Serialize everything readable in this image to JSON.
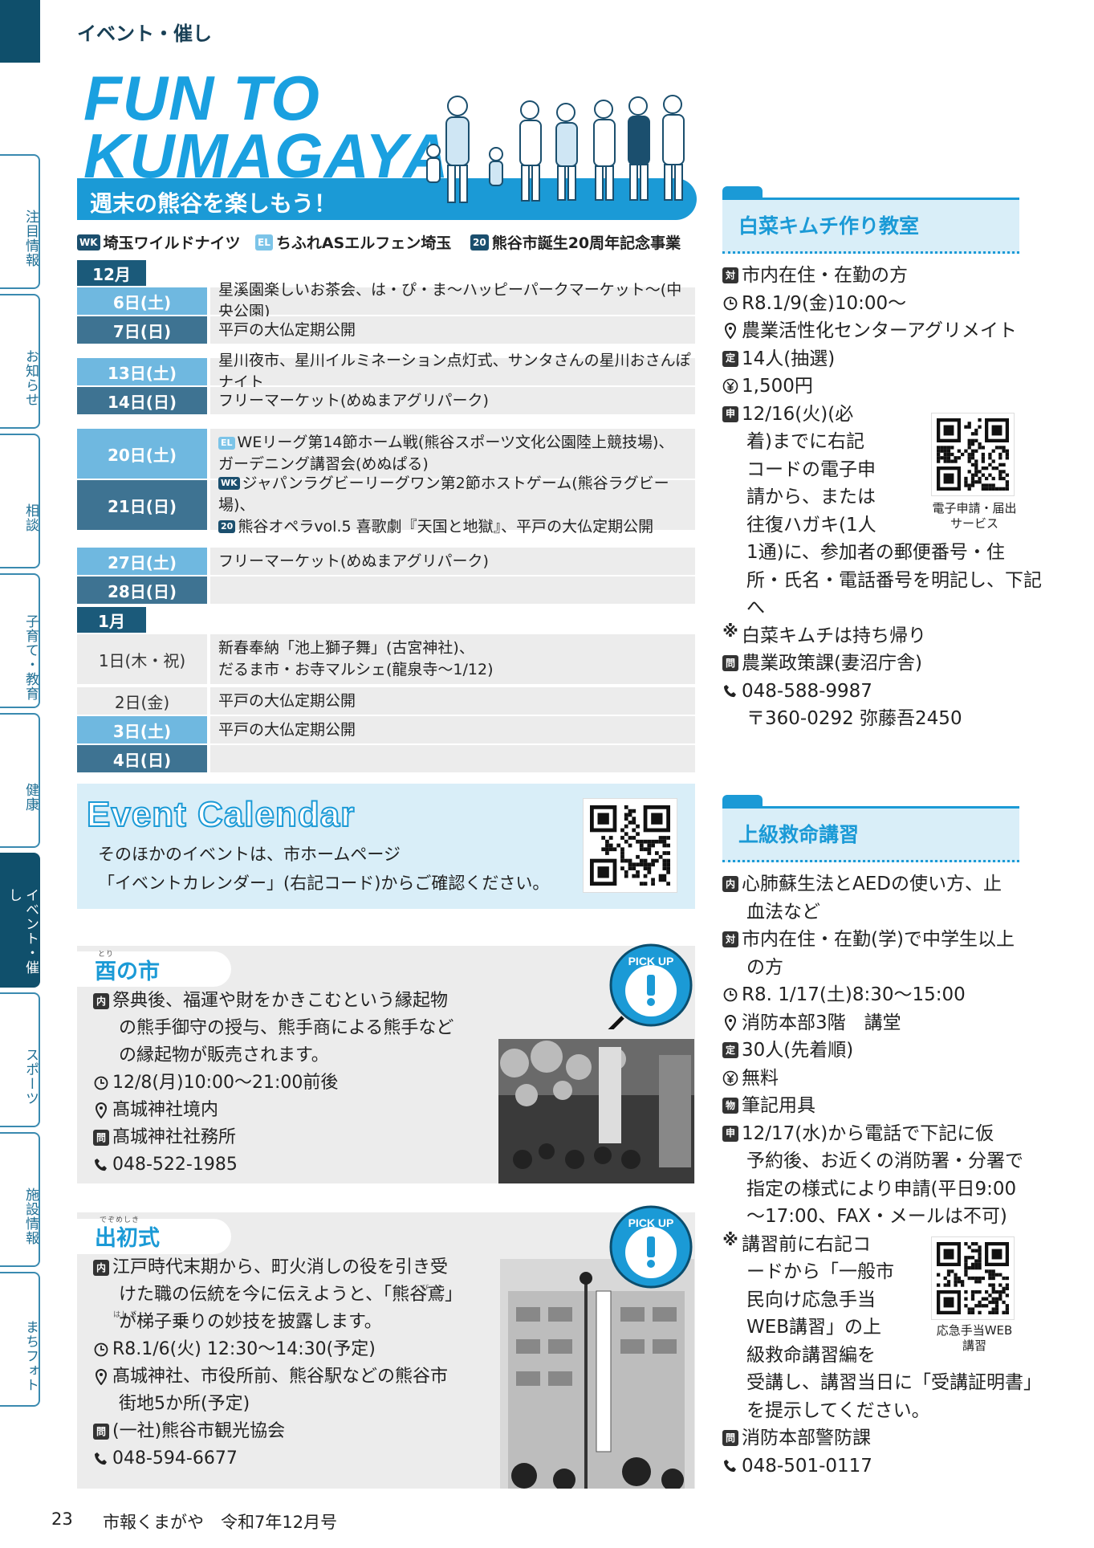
{
  "side": {
    "tabs": [
      "注目情報",
      "お知らせ",
      "相談",
      "子育て・教育",
      "健康",
      "イベント・催し",
      "スポーツ",
      "施設情報",
      "まちフォト"
    ]
  },
  "header": {
    "section": "イベント・催し",
    "hero_line1": "FUN TO",
    "hero_line2": "KUMAGAYA",
    "subtitle": "週末の熊谷を楽しもう！"
  },
  "legend": [
    {
      "badge": "WK",
      "label": "埼玉ワイルドナイツ",
      "color": "#1b4f6e"
    },
    {
      "badge": "EL",
      "label": "ちふれASエルフェン埼玉",
      "color": "#7cc4e8"
    },
    {
      "badge": "20",
      "label": "熊谷市誕生20周年記念事業",
      "color": "#1b4f6e"
    }
  ],
  "calendar": {
    "dec": "12月",
    "jan": "1月",
    "rows": [
      {
        "date": "6日(土)",
        "events": [
          "星溪園楽しいお茶会、は・ぴ・ま～ハッピーパークマーケット～(中央公園)"
        ]
      },
      {
        "date": "7日(日)",
        "events": [
          "平戸の大仏定期公開"
        ]
      },
      {
        "date": "13日(土)",
        "events": [
          "星川夜市、星川イルミネーション点灯式、サンタさんの星川おさんぽナイト"
        ]
      },
      {
        "date": "14日(日)",
        "events": [
          "フリーマーケット(めぬまアグリパーク)"
        ]
      },
      {
        "date": "20日(土)",
        "events": [
          "WEリーグ第14節ホーム戦(熊谷スポーツ文化公園陸上競技場)、",
          "ガーデニング講習会(めぬぱる)"
        ]
      },
      {
        "date": "21日(日)",
        "events": [
          "ジャパンラグビーリーグワン第2節ホストゲーム(熊谷ラグビー場)、",
          "熊谷オペラvol.5 喜歌劇『天国と地獄』、平戸の大仏定期公開"
        ]
      },
      {
        "date": "27日(土)",
        "events": [
          "フリーマーケット(めぬまアグリパーク)"
        ]
      },
      {
        "date": "28日(日)",
        "events": []
      },
      {
        "date": "1日(木・祝)",
        "events": [
          "新春奉納「池上獅子舞」(古宮神社)、",
          "だるま市・お寺マルシェ(龍泉寺～1/12)"
        ]
      },
      {
        "date": "2日(金)",
        "events": [
          "平戸の大仏定期公開"
        ]
      },
      {
        "date": "3日(土)",
        "events": [
          "平戸の大仏定期公開"
        ]
      },
      {
        "date": "4日(日)",
        "events": []
      }
    ]
  },
  "event_calendar": {
    "title": "Event Calendar",
    "line1": "そのほかのイベントは、市ホームページ",
    "line2": "「イベントカレンダー」(右記コード)からご確認ください。"
  },
  "pickup_badge": "PICK UP",
  "torinoichi": {
    "title": "酉の市",
    "ruby": "とり",
    "lines": [
      "祭典後、福運や財をかきこむという縁起物",
      "の熊手御守の授与、熊手商による熊手など",
      "の縁起物が販売されます。",
      "12/8(月)10:00～21:00前後",
      "髙城神社境内",
      "髙城神社社務所",
      "048-522-1985"
    ],
    "icons": [
      "内",
      "",
      "",
      "clock",
      "pin",
      "問",
      "tel"
    ]
  },
  "dezomeshiki": {
    "title": "出初式",
    "ruby": "でぞめしき",
    "ruby2": "とび",
    "ruby3": "はしご",
    "lines": [
      "江戸時代末期から、町火消しの役を引き受",
      "けた職の伝統を今に伝えようと、「熊谷鳶」",
      "が梯子乗りの妙技を披露します。",
      "R8.1/6(火) 12:30～14:30(予定)",
      "髙城神社、市役所前、熊谷駅などの熊谷市",
      "街地5か所(予定)",
      "(一社)熊谷市観光協会",
      "048-594-6677"
    ],
    "icons": [
      "内",
      "",
      "",
      "clock",
      "pin",
      "",
      "問",
      "tel"
    ]
  },
  "kimchi": {
    "title": "白菜キムチ作り教室",
    "lines": [
      "市内在住・在勤の方",
      "R8.1/9(金)10:00～",
      "農業活性化センターアグリメイト",
      "14人(抽選)",
      "1,500円",
      "12/16(火)(必",
      "着)までに右記",
      "コードの電子申",
      "請から、または",
      "往復ハガキ(1人",
      "1通)に、参加者の郵便番号・住",
      "所・氏名・電話番号を明記し、下記",
      "へ",
      "白菜キムチは持ち帰り",
      "農業政策課(妻沼庁舎)",
      "048-588-9987",
      "〒360-0292 弥藤吾2450"
    ],
    "icons": [
      "対",
      "clock",
      "pin",
      "定",
      "yen",
      "申",
      "",
      "",
      "",
      "",
      "",
      "",
      "",
      "※",
      "問",
      "tel",
      ""
    ],
    "qr_caption": [
      "電子申請・届出",
      "サービス"
    ]
  },
  "kyumei": {
    "title": "上級救命講習",
    "lines": [
      "心肺蘇生法とAEDの使い方、止",
      "血法など",
      "市内在住・在勤(学)で中学生以上",
      "の方",
      "R8. 1/17(土)8:30～15:00",
      "消防本部3階　講堂",
      "30人(先着順)",
      "無料",
      "筆記用具",
      "12/17(水)から電話で下記に仮",
      "予約後、お近くの消防署・分署で",
      "指定の様式により申請(平日9:00",
      "～17:00、FAX・メールは不可)",
      "講習前に右記コ",
      "ードから「一般市",
      "民向け応急手当",
      "WEB講習」の上",
      "級救命講習編を",
      "受講し、講習当日に「受講証明書」",
      "を提示してください。",
      "消防本部警防課",
      "048-501-0117"
    ],
    "icons": [
      "内",
      "",
      "対",
      "",
      "clock",
      "pin",
      "定",
      "yen",
      "物",
      "申",
      "",
      "",
      "",
      "※",
      "",
      "",
      "",
      "",
      "",
      "",
      "問",
      "tel"
    ],
    "qr_caption": [
      "応急手当WEB",
      "講習"
    ]
  },
  "footer": {
    "page": "23",
    "title": "市報くまがや　令和7年12月号"
  }
}
